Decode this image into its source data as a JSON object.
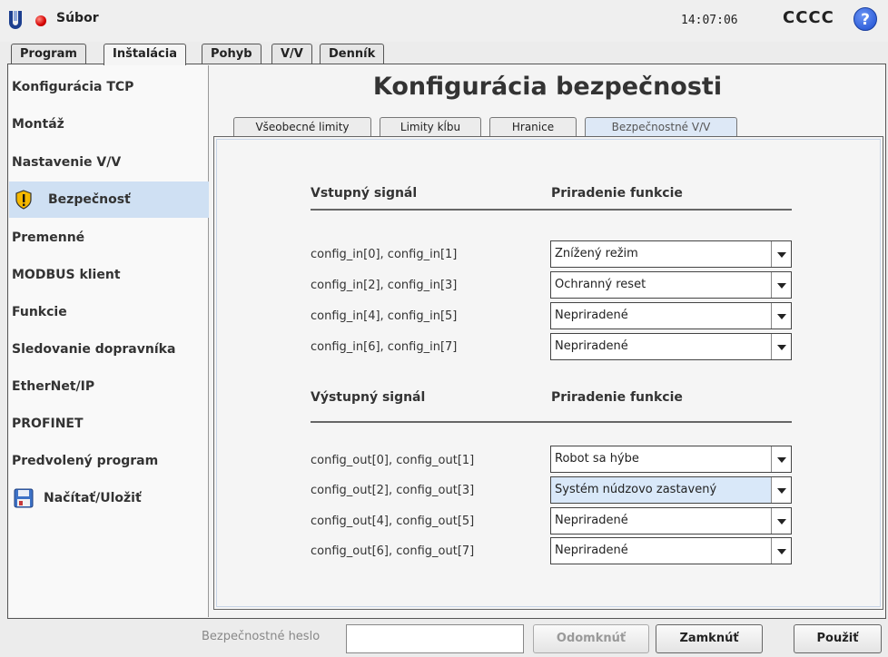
{
  "titlebar": {
    "file_label": "Súbor",
    "clock": "14:07:06",
    "robot_name": "CCCC",
    "help": "?"
  },
  "main_tabs": [
    {
      "label": "Program"
    },
    {
      "label": "Inštalácia"
    },
    {
      "label": "Pohyb"
    },
    {
      "label": "V/V"
    },
    {
      "label": "Denník"
    }
  ],
  "active_main_tab": "Inštalácia",
  "sidebar": {
    "items": [
      {
        "label": "Konfigurácia TCP"
      },
      {
        "label": "Montáž"
      },
      {
        "label": "Nastavenie V/V"
      },
      {
        "label": "Bezpečnosť",
        "icon": "warning-shield-icon"
      },
      {
        "label": "Premenné"
      },
      {
        "label": "MODBUS klient"
      },
      {
        "label": "Funkcie"
      },
      {
        "label": "Sledovanie dopravníka"
      },
      {
        "label": "EtherNet/IP"
      },
      {
        "label": "PROFINET"
      },
      {
        "label": "Predvolený program"
      },
      {
        "label": "Načítať/Uložiť",
        "icon": "floppy-disk-icon"
      }
    ],
    "active": "Bezpečnosť"
  },
  "page": {
    "title": "Konfigurácia bezpečnosti"
  },
  "sub_tabs": [
    {
      "label": "Všeobecné limity"
    },
    {
      "label": "Limity kĺbu"
    },
    {
      "label": "Hranice"
    },
    {
      "label": "Bezpečnostné V/V"
    }
  ],
  "active_sub_tab": "Bezpečnostné V/V",
  "inputs": {
    "header_signal": "Vstupný signál",
    "header_function": "Priradenie funkcie",
    "rows": [
      {
        "signal": "config_in[0], config_in[1]",
        "value": "Znížený režim"
      },
      {
        "signal": "config_in[2], config_in[3]",
        "value": "Ochranný reset"
      },
      {
        "signal": "config_in[4], config_in[5]",
        "value": "Nepriradené"
      },
      {
        "signal": "config_in[6], config_in[7]",
        "value": "Nepriradené"
      }
    ]
  },
  "outputs": {
    "header_signal": "Výstupný signál",
    "header_function": "Priradenie funkcie",
    "rows": [
      {
        "signal": "config_out[0], config_out[1]",
        "value": "Robot sa hýbe"
      },
      {
        "signal": "config_out[2], config_out[3]",
        "value": "Systém núdzovo zastavený"
      },
      {
        "signal": "config_out[4], config_out[5]",
        "value": "Nepriradené"
      },
      {
        "signal": "config_out[6], config_out[7]",
        "value": "Nepriradené"
      }
    ]
  },
  "footer": {
    "password_label": "Bezpečnostné heslo",
    "password_value": "",
    "unlock_label": "Odomknúť",
    "lock_label": "Zamknúť",
    "apply_label": "Použiť"
  },
  "colors": {
    "selected_bg": "#cfe0f3",
    "status_dot": "#d50000",
    "help": "#1b4ccf"
  }
}
